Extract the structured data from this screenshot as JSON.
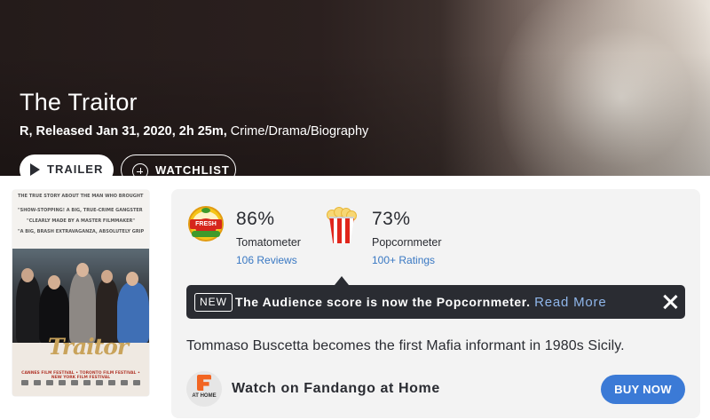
{
  "hero": {
    "title": "The Traitor",
    "rating_release": "R, Released Jan 31, 2020, 2h 25m,",
    "genre": "Crime/Drama/Biography",
    "trailer_label": "TRAILER",
    "watchlist_label": "WATCHLIST"
  },
  "poster": {
    "tagline": "THE TRUE STORY ABOUT THE MAN WHO BROUGHT DOWN THE MAFIA",
    "quote1": "\"SHOW-STOPPING! A BIG, TRUE-CRIME GANGSTER MOVIE\"",
    "quote2": "\"CLEARLY MADE BY A MASTER FILMMAKER\"",
    "quote3": "\"A BIG, BRASH EXTRAVAGANZA, ABSOLUTELY GRIPPING\"",
    "title": "Traitor",
    "festival": "CANNES FILM FESTIVAL • TORONTO FILM FESTIVAL • NEW YORK FILM FESTIVAL"
  },
  "scores": {
    "tomatometer": {
      "value": "86%",
      "label": "Tomatometer",
      "reviews": "106 Reviews",
      "badge_top": "CERTIFIED",
      "badge_text": "FRESH"
    },
    "popcornmeter": {
      "value": "73%",
      "label": "Popcornmeter",
      "ratings": "100+ Ratings"
    }
  },
  "notice": {
    "badge": "NEW",
    "text": "The Audience score is now the Popcornmeter.",
    "link": "Read More"
  },
  "synopsis": "Tommaso Buscetta becomes the first Mafia informant in 1980s Sicily.",
  "fandango": {
    "icon_label": "AT HOME",
    "text": "Watch on Fandango at Home",
    "buy_label": "BUY NOW"
  },
  "colors": {
    "link_blue": "#3978c3",
    "button_blue": "#3b7ad6",
    "notice_bg": "#2a2c32",
    "tomato_red": "#d6261c"
  }
}
